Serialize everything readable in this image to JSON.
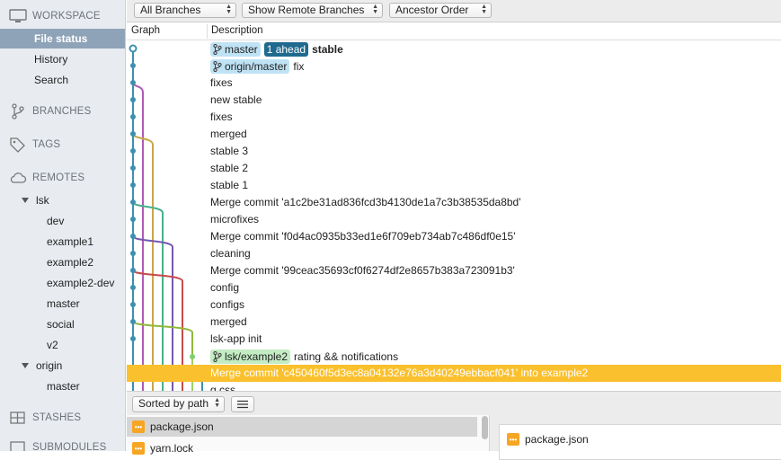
{
  "sidebar": {
    "workspace_label": "WORKSPACE",
    "workspace_items": [
      "File status",
      "History",
      "Search"
    ],
    "branches_label": "BRANCHES",
    "tags_label": "TAGS",
    "remotes_label": "REMOTES",
    "remotes": [
      {
        "name": "lsk",
        "branches": [
          "dev",
          "example1",
          "example2",
          "example2-dev",
          "master",
          "social",
          "v2"
        ]
      },
      {
        "name": "origin",
        "branches": [
          "master"
        ]
      }
    ],
    "stashes_label": "STASHES",
    "submodules_label": "SUBMODULES"
  },
  "toolbar": {
    "branches_filter": "All Branches",
    "remote_filter": "Show Remote Branches",
    "order_filter": "Ancestor Order"
  },
  "columns": {
    "graph": "Graph",
    "description": "Description"
  },
  "commits": [
    {
      "refs": [
        {
          "label": "master",
          "kind": "branch"
        },
        {
          "label": "1 ahead",
          "kind": "ahead"
        }
      ],
      "message": "stable",
      "bold": true
    },
    {
      "refs": [
        {
          "label": "origin/master",
          "kind": "branch"
        }
      ],
      "message": "fix"
    },
    {
      "refs": [],
      "message": "fixes"
    },
    {
      "refs": [],
      "message": "new stable"
    },
    {
      "refs": [],
      "message": "fixes"
    },
    {
      "refs": [],
      "message": "merged"
    },
    {
      "refs": [],
      "message": "stable 3"
    },
    {
      "refs": [],
      "message": "stable 2"
    },
    {
      "refs": [],
      "message": "stable 1"
    },
    {
      "refs": [],
      "message": "Merge commit 'a1c2be31ad836fcd3b4130de1a7c3b38535da8bd'"
    },
    {
      "refs": [],
      "message": "microfixes"
    },
    {
      "refs": [],
      "message": "Merge commit 'f0d4ac0935b33ed1e6f709eb734ab7c486df0e15'"
    },
    {
      "refs": [],
      "message": "cleaning"
    },
    {
      "refs": [],
      "message": "Merge commit '99ceac35693cf0f6274df2e8657b383a723091b3'"
    },
    {
      "refs": [],
      "message": "config"
    },
    {
      "refs": [],
      "message": "configs"
    },
    {
      "refs": [],
      "message": "merged"
    },
    {
      "refs": [],
      "message": "lsk-app init"
    },
    {
      "refs": [
        {
          "label": "lsk/example2",
          "kind": "remote"
        }
      ],
      "message": "rating && notifications"
    },
    {
      "refs": [],
      "message": "Merge commit 'c450460f5d3ec8a04132e76a3d40249ebbacf041' into example2",
      "selected": true
    },
    {
      "refs": [],
      "message": "g.css"
    }
  ],
  "bottom": {
    "sort_label": "Sorted by path",
    "files": [
      "package.json",
      "yarn.lock"
    ],
    "preview_file": "package.json"
  },
  "colors": {
    "selected_row": "#fbc02d",
    "accent_blue": "#3d8fb0",
    "ahead_badge": "#1f6a8e"
  }
}
